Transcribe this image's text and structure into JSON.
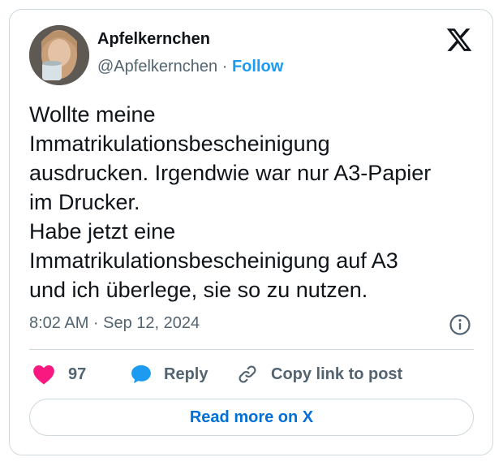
{
  "author": {
    "display_name": "Apfelkernchen",
    "handle": "@Apfelkernchen",
    "separator": "·",
    "follow_label": "Follow"
  },
  "tweet": {
    "text": "Wollte meine\nImmatrikulationsbescheinigung\nausdrucken. Irgendwie war nur A3-Papier\nim Drucker.\nHabe jetzt eine\nImmatrikulationsbescheinigung auf A3\nund ich überlege, sie so zu nutzen.",
    "timestamp": "8:02 AM · Sep 12, 2024"
  },
  "actions": {
    "like_count": "97",
    "reply_label": "Reply",
    "copy_label": "Copy link to post"
  },
  "read_more_label": "Read more on X",
  "icons": {
    "platform": "x-logo-icon",
    "info": "info-icon",
    "like": "heart-icon",
    "reply": "speech-bubble-icon",
    "copy": "link-icon"
  },
  "colors": {
    "accent": "#1d9bf0",
    "heart": "#f91880",
    "muted": "#536471",
    "border": "#cfd9de",
    "read_more": "#006fd6"
  }
}
